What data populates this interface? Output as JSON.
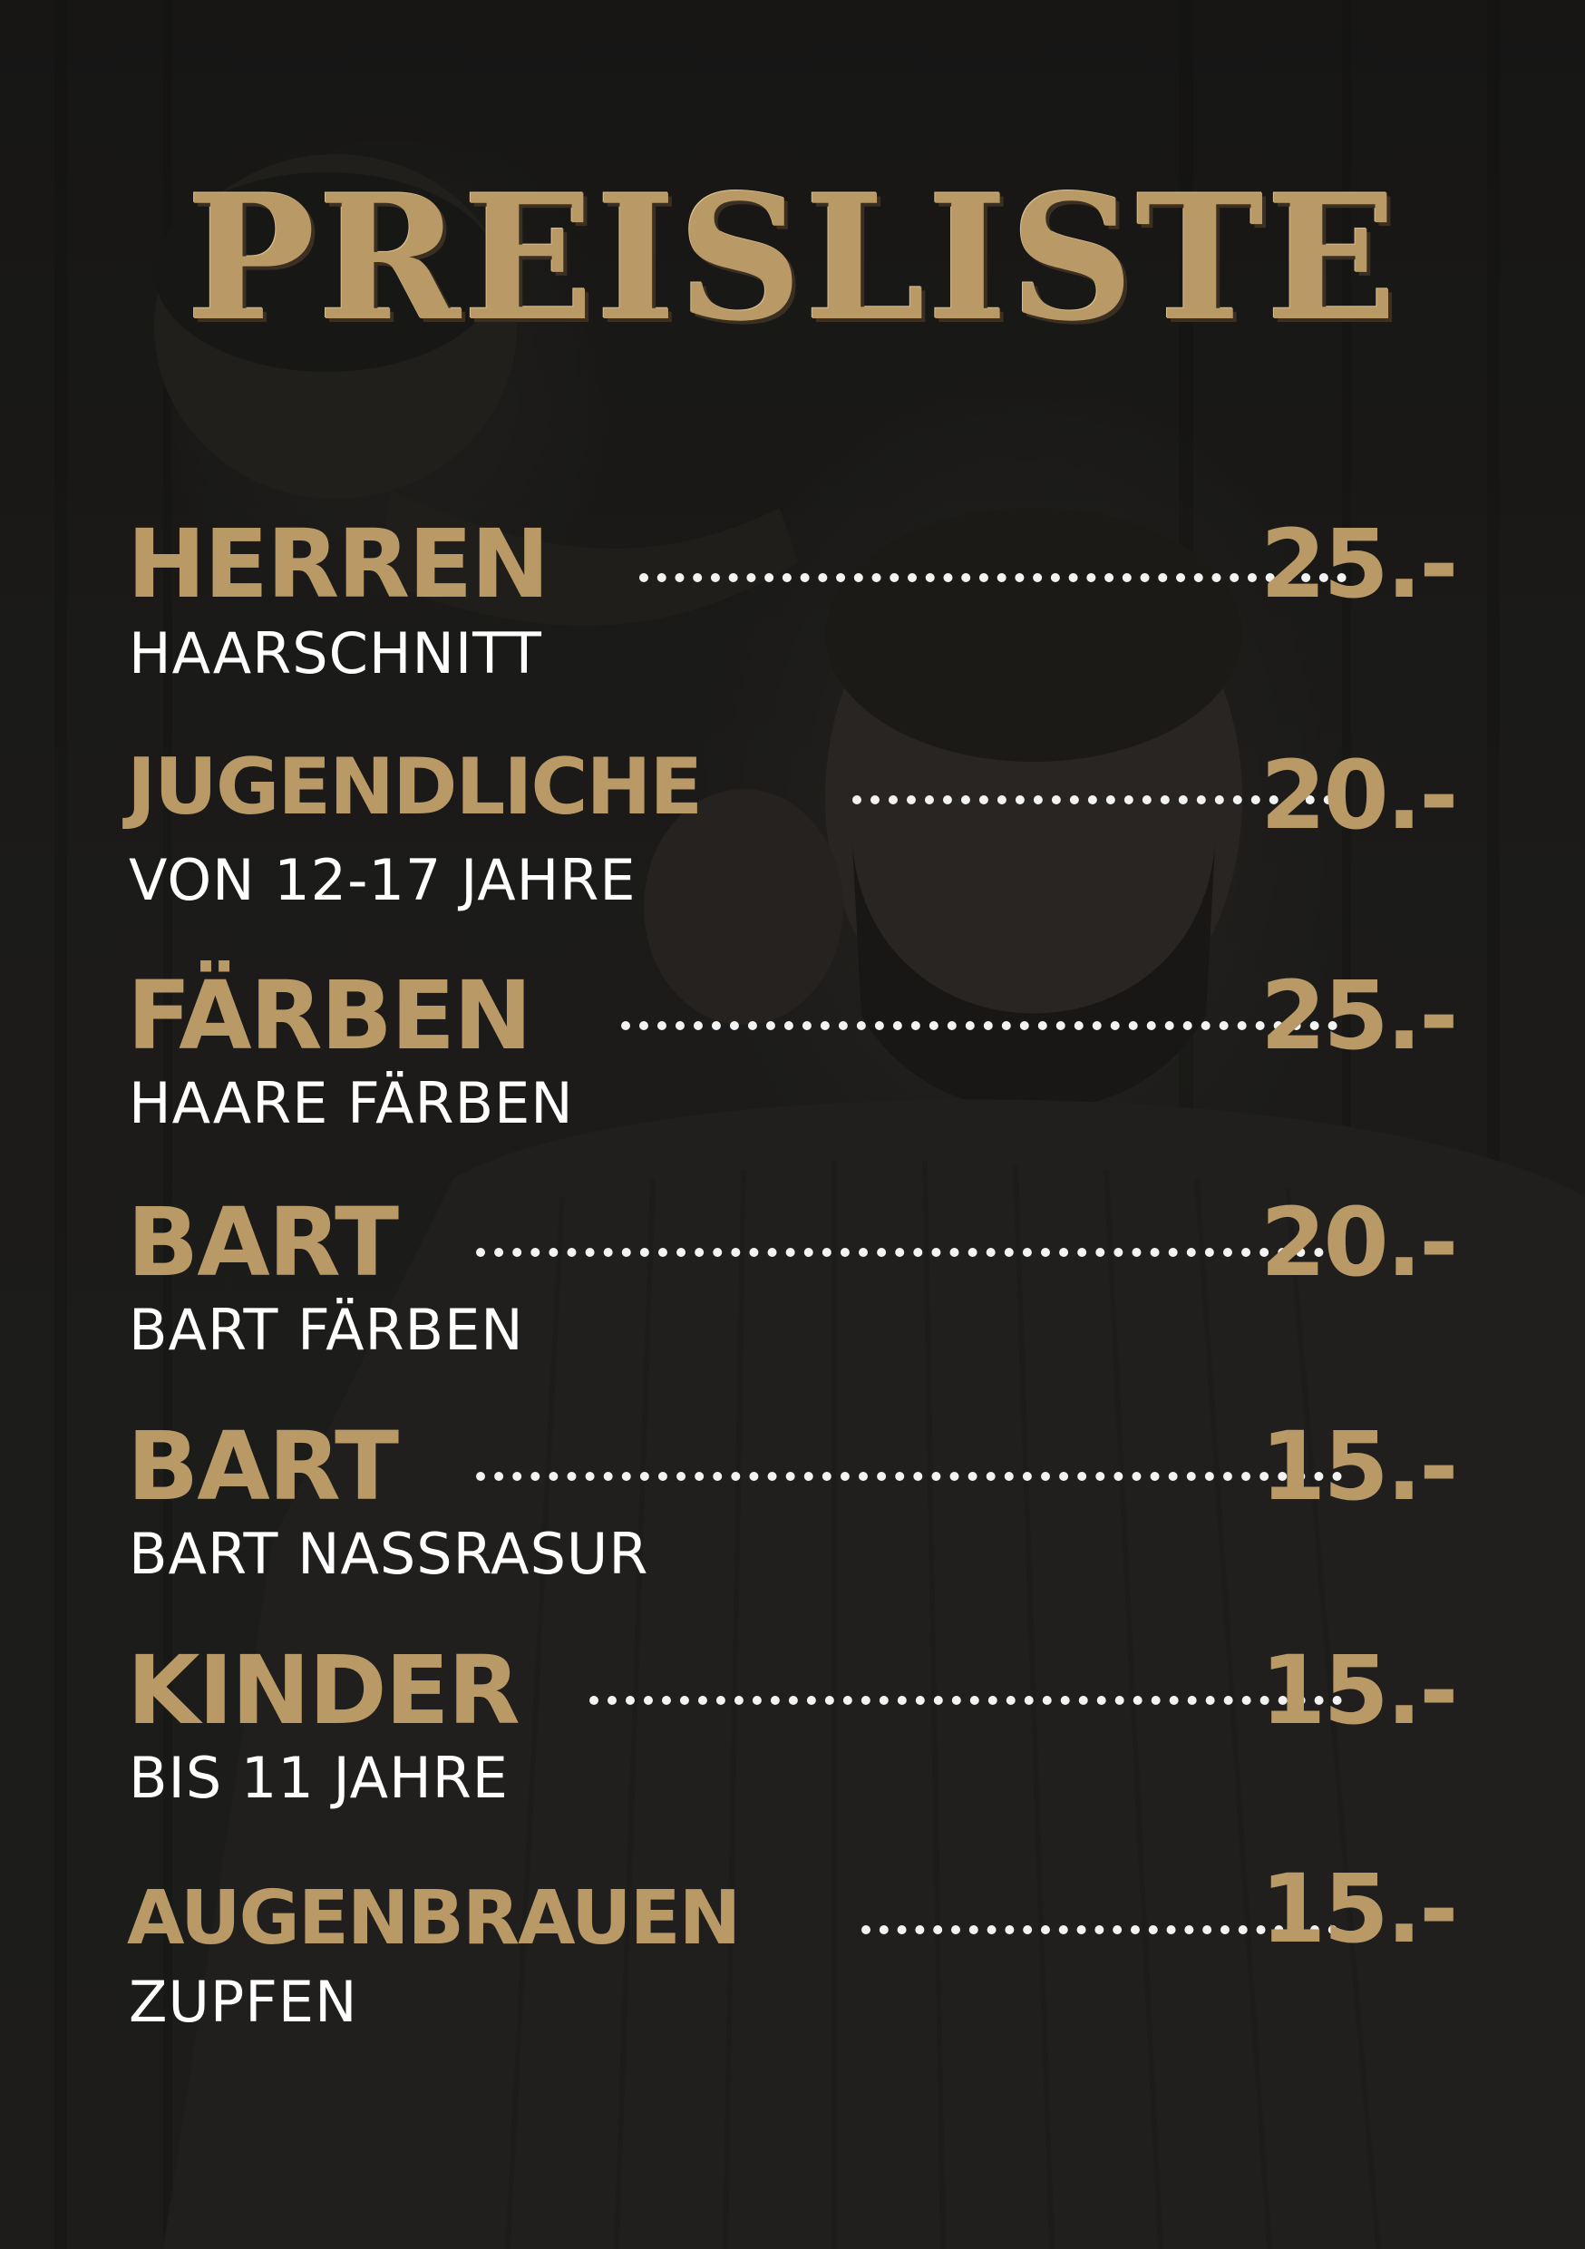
{
  "title": "PREISLISTE",
  "accent_color": "#b99a66",
  "items": [
    {
      "name": "HERREN",
      "description": "HAARSCHNITT",
      "price": "25.-"
    },
    {
      "name": "JUGENDLICHE",
      "description": "VON 12-17 JAHRE",
      "price": "20.-"
    },
    {
      "name": "FÄRBEN",
      "description": "HAARE FÄRBEN",
      "price": "25.-"
    },
    {
      "name": "BART",
      "description": "BART FÄRBEN",
      "price": "20.-"
    },
    {
      "name": "BART",
      "description": "BART NASSRASUR",
      "price": "15.-"
    },
    {
      "name": "KINDER",
      "description": "BIS 11 JAHRE",
      "price": "15.-"
    },
    {
      "name": "AUGENBRAUEN",
      "description": "ZUPFEN",
      "price": "15.-"
    }
  ]
}
